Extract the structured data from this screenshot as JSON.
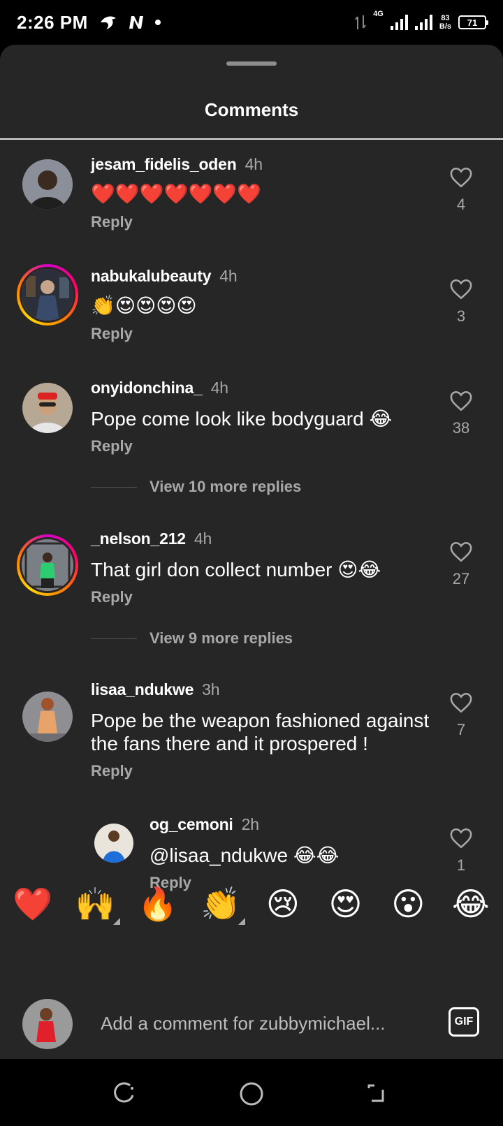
{
  "status_bar": {
    "time": "2:26 PM",
    "network": "4G",
    "speed_value": "83",
    "speed_unit": "B/s",
    "battery": "71"
  },
  "sheet": {
    "title": "Comments"
  },
  "comments": [
    {
      "username": "jesam_fidelis_oden",
      "time": "4h",
      "text": "❤️❤️❤️❤️❤️❤️❤️",
      "reply": "Reply",
      "likes": "4"
    },
    {
      "username": "nabukalubeauty",
      "time": "4h",
      "text": "👏😍😍😍😍",
      "reply": "Reply",
      "likes": "3"
    },
    {
      "username": "onyidonchina_",
      "time": "4h",
      "text": "Pope come look like bodyguard 😂",
      "reply": "Reply",
      "likes": "38",
      "view_more": "View 10 more replies"
    },
    {
      "username": "_nelson_212",
      "time": "4h",
      "text": "That girl don collect number 😍😂",
      "reply": "Reply",
      "likes": "27",
      "view_more": "View 9 more replies"
    },
    {
      "username": "lisaa_ndukwe",
      "time": "3h",
      "text_line1": "Pope be the weapon fashioned against",
      "text_line2": "the fans there and it prospered !",
      "reply": "Reply",
      "likes": "7"
    },
    {
      "username": "og_cemoni",
      "time": "2h",
      "text": "@lisaa_ndukwe 😂😂",
      "reply": "Reply",
      "likes": "1"
    }
  ],
  "quick_reactions": [
    "❤️",
    "🙌",
    "🔥",
    "👏",
    "😢",
    "😍",
    "😮",
    "😂"
  ],
  "composer": {
    "placeholder": "Add a comment for zubbymichael...",
    "gif_label": "GIF"
  }
}
